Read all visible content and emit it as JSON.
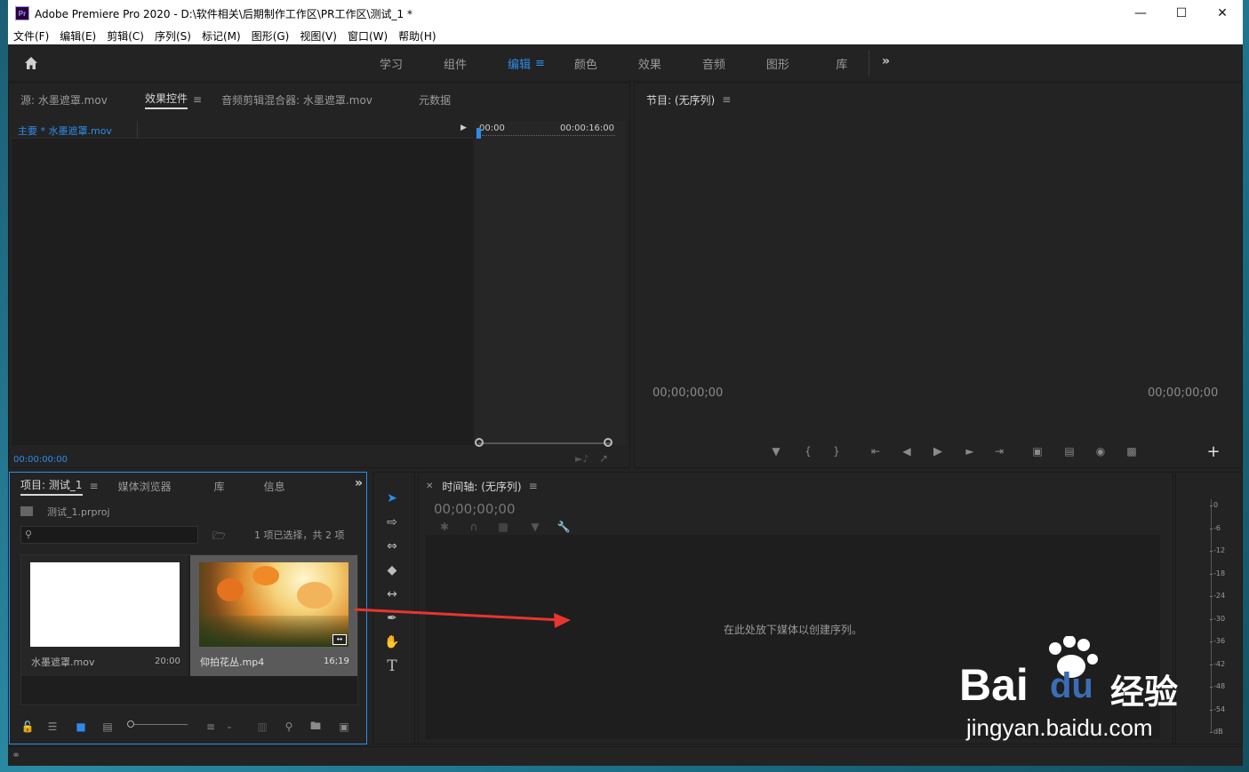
{
  "window": {
    "title": "Adobe Premiere Pro 2020 - D:\\软件相关\\后期制作工作区\\PR工作区\\测试_1 *",
    "app_icon": "Pr"
  },
  "menu": [
    "文件(F)",
    "编辑(E)",
    "剪辑(C)",
    "序列(S)",
    "标记(M)",
    "图形(G)",
    "视图(V)",
    "窗口(W)",
    "帮助(H)"
  ],
  "workspaces": {
    "tabs": [
      "学习",
      "组件",
      "编辑",
      "颜色",
      "效果",
      "音频",
      "图形",
      "库"
    ],
    "active": "编辑",
    "accent_color": "#2d8ceb"
  },
  "source_panel": {
    "tabs": [
      "源: 水墨遮罩.mov",
      "效果控件",
      "音频剪辑混合器: 水墨遮罩.mov",
      "元数据"
    ],
    "active_tab": "效果控件",
    "clip_label": "主要 * 水墨遮罩.mov",
    "time_start": "00:00",
    "time_end": "00:00:16:00",
    "timecode": "00:00:00:00"
  },
  "program_monitor": {
    "title": "节目: (无序列)",
    "timecode_left": "00;00;00;00",
    "timecode_right": "00;00;00;00"
  },
  "project_panel": {
    "tabs": [
      "项目: 测试_1",
      "媒体浏览器",
      "库",
      "信息"
    ],
    "project_file": "测试_1.prproj",
    "selection_status": "1 项已选择，共 2 项",
    "search_placeholder": "",
    "items": [
      {
        "name": "水墨遮罩.mov",
        "duration": "20:00",
        "thumb": "white"
      },
      {
        "name": "仰拍花丛.mp4",
        "duration": "16;19",
        "thumb": "flowers"
      }
    ]
  },
  "timeline": {
    "title": "时间轴: (无序列)",
    "timecode": "00;00;00;00",
    "drop_hint": "在此处放下媒体以创建序列。"
  },
  "audio_meter": {
    "labels": [
      "0",
      "-6",
      "-12",
      "-18",
      "-24",
      "-30",
      "-36",
      "-42",
      "-48",
      "-54",
      "dB"
    ]
  },
  "watermark": {
    "brand": "Bai",
    "brand2": "du",
    "brand_cn": "经验",
    "url": "jingyan.baidu.com"
  }
}
